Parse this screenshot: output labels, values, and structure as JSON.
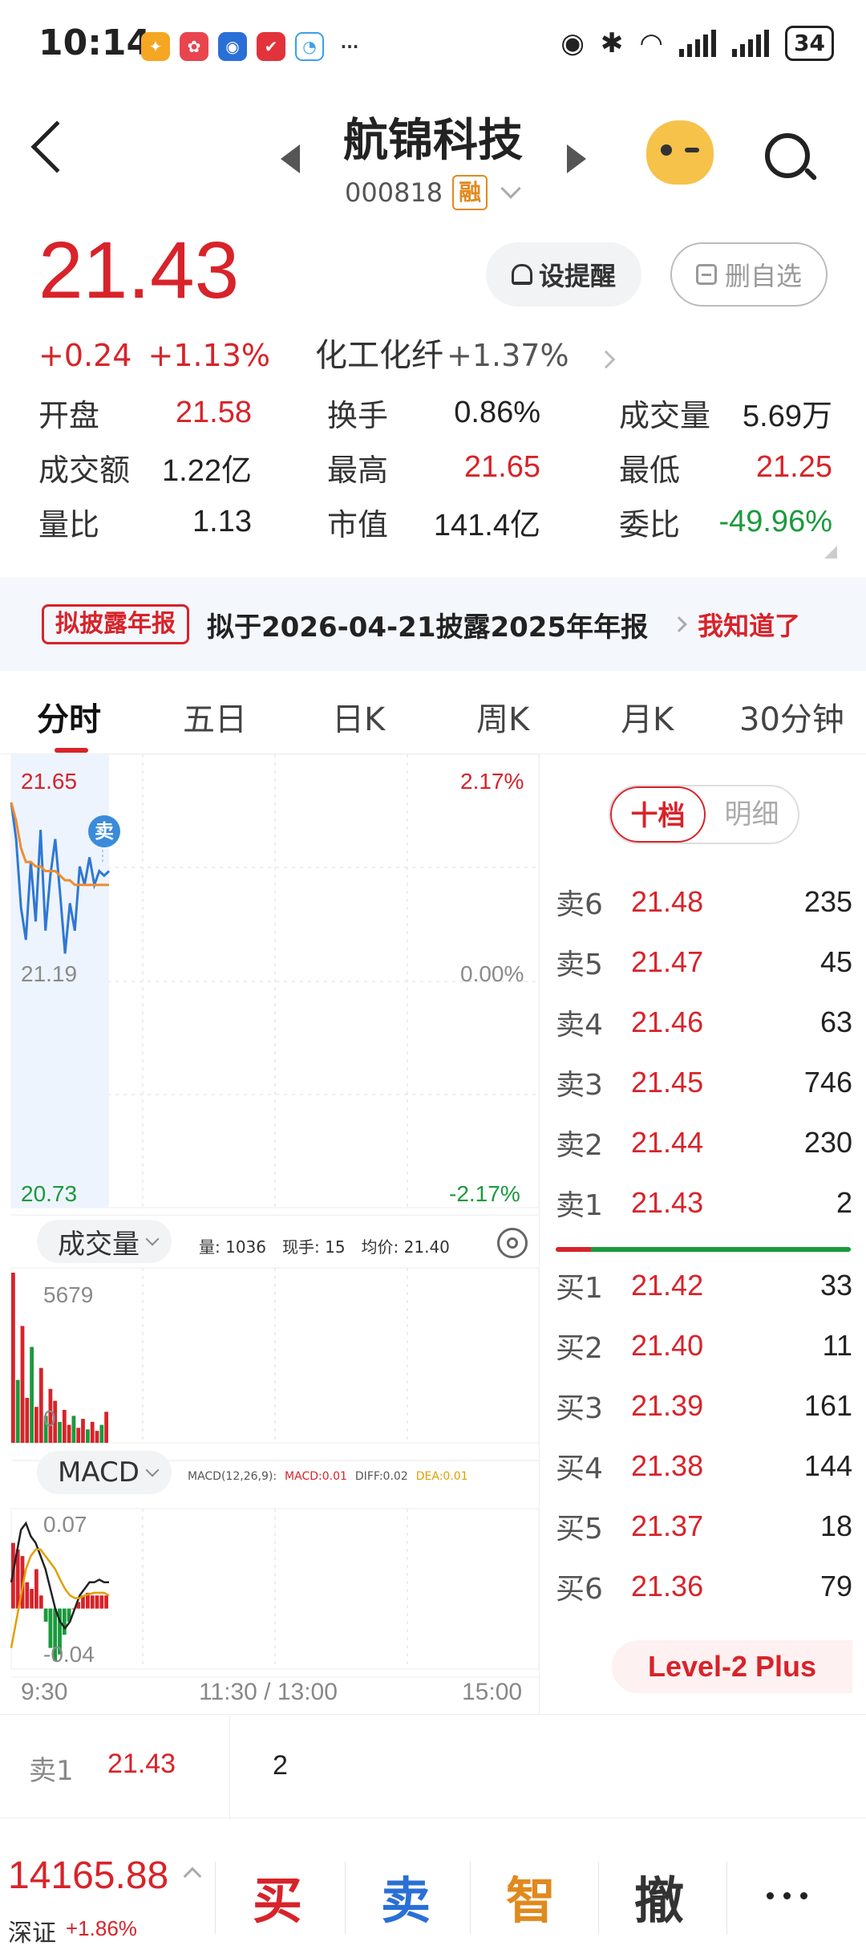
{
  "status_bar": {
    "time": "10:14",
    "battery": "34",
    "more": "···"
  },
  "header": {
    "title": "航锦科技",
    "code": "000818",
    "margin_badge": "融"
  },
  "quote": {
    "price": "21.43",
    "change": "+0.24",
    "change_pct": "+1.13%",
    "sector": "化工化纤",
    "sector_change": "+1.37%",
    "alert_label": "设提醒",
    "remove_label": "删自选"
  },
  "stats": [
    [
      {
        "label": "开盘",
        "value": "21.58",
        "color": "red"
      },
      {
        "label": "换手",
        "value": "0.86%",
        "color": "black"
      },
      {
        "label": "成交量",
        "value": "5.69万",
        "color": "black"
      }
    ],
    [
      {
        "label": "成交额",
        "value": "1.22亿",
        "color": "black"
      },
      {
        "label": "最高",
        "value": "21.65",
        "color": "red"
      },
      {
        "label": "最低",
        "value": "21.25",
        "color": "red"
      }
    ],
    [
      {
        "label": "量比",
        "value": "1.13",
        "color": "black"
      },
      {
        "label": "市值",
        "value": "141.4亿",
        "color": "black"
      },
      {
        "label": "委比",
        "value": "-49.96%",
        "color": "green"
      }
    ]
  ],
  "announcement": {
    "tag": "拟披露年报",
    "text": "拟于2026-04-21披露2025年年报",
    "action": "我知道了"
  },
  "tabs": [
    "分时",
    "五日",
    "日K",
    "周K",
    "月K",
    "30分钟"
  ],
  "chart": {
    "price_high": "21.65",
    "price_mid": "21.19",
    "price_low": "20.73",
    "pct_high": "2.17%",
    "pct_mid": "0.00%",
    "pct_low": "-2.17%",
    "sell_marker": "卖",
    "volume_panel": {
      "label": "成交量",
      "vol": "量: 1036",
      "hand": "现手: 15",
      "avg": "均价: 21.40",
      "max": "5679",
      "min": "0"
    },
    "macd_panel": {
      "label": "MACD",
      "params": "MACD(12,26,9):",
      "macd": "MACD:0.01",
      "diff": "DIFF:0.02",
      "dea": "DEA:0.01",
      "max": "0.07",
      "min": "-0.04"
    },
    "time_start": "9:30",
    "time_mid": "11:30 / 13:00",
    "time_end": "15:00"
  },
  "chart_data": {
    "type": "line",
    "title": "",
    "ylim": [
      20.73,
      21.65
    ],
    "series": [
      {
        "values": [
          21.58,
          21.5,
          21.35,
          21.28,
          21.45,
          21.32,
          21.52,
          21.3,
          21.42,
          21.5,
          21.38,
          21.25,
          21.36,
          21.3,
          21.44,
          21.4,
          21.46,
          21.4,
          21.43,
          21.42,
          21.43
        ]
      },
      {
        "values": [
          21.58,
          21.54,
          21.48,
          21.45,
          21.45,
          21.44,
          21.44,
          21.43,
          21.43,
          21.43,
          21.42,
          21.41,
          21.41,
          21.4,
          21.4,
          21.4,
          21.4,
          21.4,
          21.4,
          21.4,
          21.4
        ]
      }
    ],
    "volume": [
      5679,
      2100,
      3900,
      1500,
      3200,
      1200,
      2500,
      900,
      1800,
      1400,
      700,
      1100,
      600,
      900,
      500,
      800,
      450,
      700,
      400,
      600,
      1036
    ],
    "macd_hist": [
      0.05,
      0.045,
      0.04,
      0.02,
      0.015,
      0.03,
      0.01,
      -0.01,
      -0.03,
      -0.04,
      -0.035,
      -0.02,
      -0.01,
      0.0,
      0.005,
      0.01,
      0.012,
      0.01,
      0.01,
      0.01,
      0.01
    ],
    "diff": [
      0.02,
      0.04,
      0.06,
      0.065,
      0.055,
      0.05,
      0.04,
      0.03,
      0.015,
      0.0,
      -0.01,
      -0.015,
      -0.01,
      0.0,
      0.01,
      0.015,
      0.02,
      0.02,
      0.022,
      0.02,
      0.02
    ],
    "dea": [
      -0.03,
      -0.01,
      0.01,
      0.03,
      0.04,
      0.045,
      0.045,
      0.04,
      0.035,
      0.03,
      0.022,
      0.015,
      0.01,
      0.008,
      0.008,
      0.01,
      0.011,
      0.012,
      0.012,
      0.012,
      0.01
    ],
    "colors": {
      "price": "#2f78d4",
      "avg": "#f08c2e",
      "up": "#d8232a",
      "down": "#1a9a3c"
    }
  },
  "order_book": {
    "toggle_on": "十档",
    "toggle_off": "明细",
    "asks": [
      {
        "label": "卖6",
        "price": "21.48",
        "vol": "235"
      },
      {
        "label": "卖5",
        "price": "21.47",
        "vol": "45"
      },
      {
        "label": "卖4",
        "price": "21.46",
        "vol": "63"
      },
      {
        "label": "卖3",
        "price": "21.45",
        "vol": "746"
      },
      {
        "label": "卖2",
        "price": "21.44",
        "vol": "230"
      },
      {
        "label": "卖1",
        "price": "21.43",
        "vol": "2"
      }
    ],
    "bids": [
      {
        "label": "买1",
        "price": "21.42",
        "vol": "33"
      },
      {
        "label": "买2",
        "price": "21.40",
        "vol": "11"
      },
      {
        "label": "买3",
        "price": "21.39",
        "vol": "161"
      },
      {
        "label": "买4",
        "price": "21.38",
        "vol": "144"
      },
      {
        "label": "买5",
        "price": "21.37",
        "vol": "18"
      },
      {
        "label": "买6",
        "price": "21.36",
        "vol": "79"
      }
    ],
    "level2": "Level-2 Plus"
  },
  "bottom_quote": {
    "label": "卖1",
    "price": "21.43",
    "vol": "2"
  },
  "bottom_bar": {
    "index_value": "14165.88",
    "index_name": "深证",
    "index_change": "+1.86%",
    "buy": "买",
    "sell": "卖",
    "smart": "智",
    "cancel": "撤"
  }
}
